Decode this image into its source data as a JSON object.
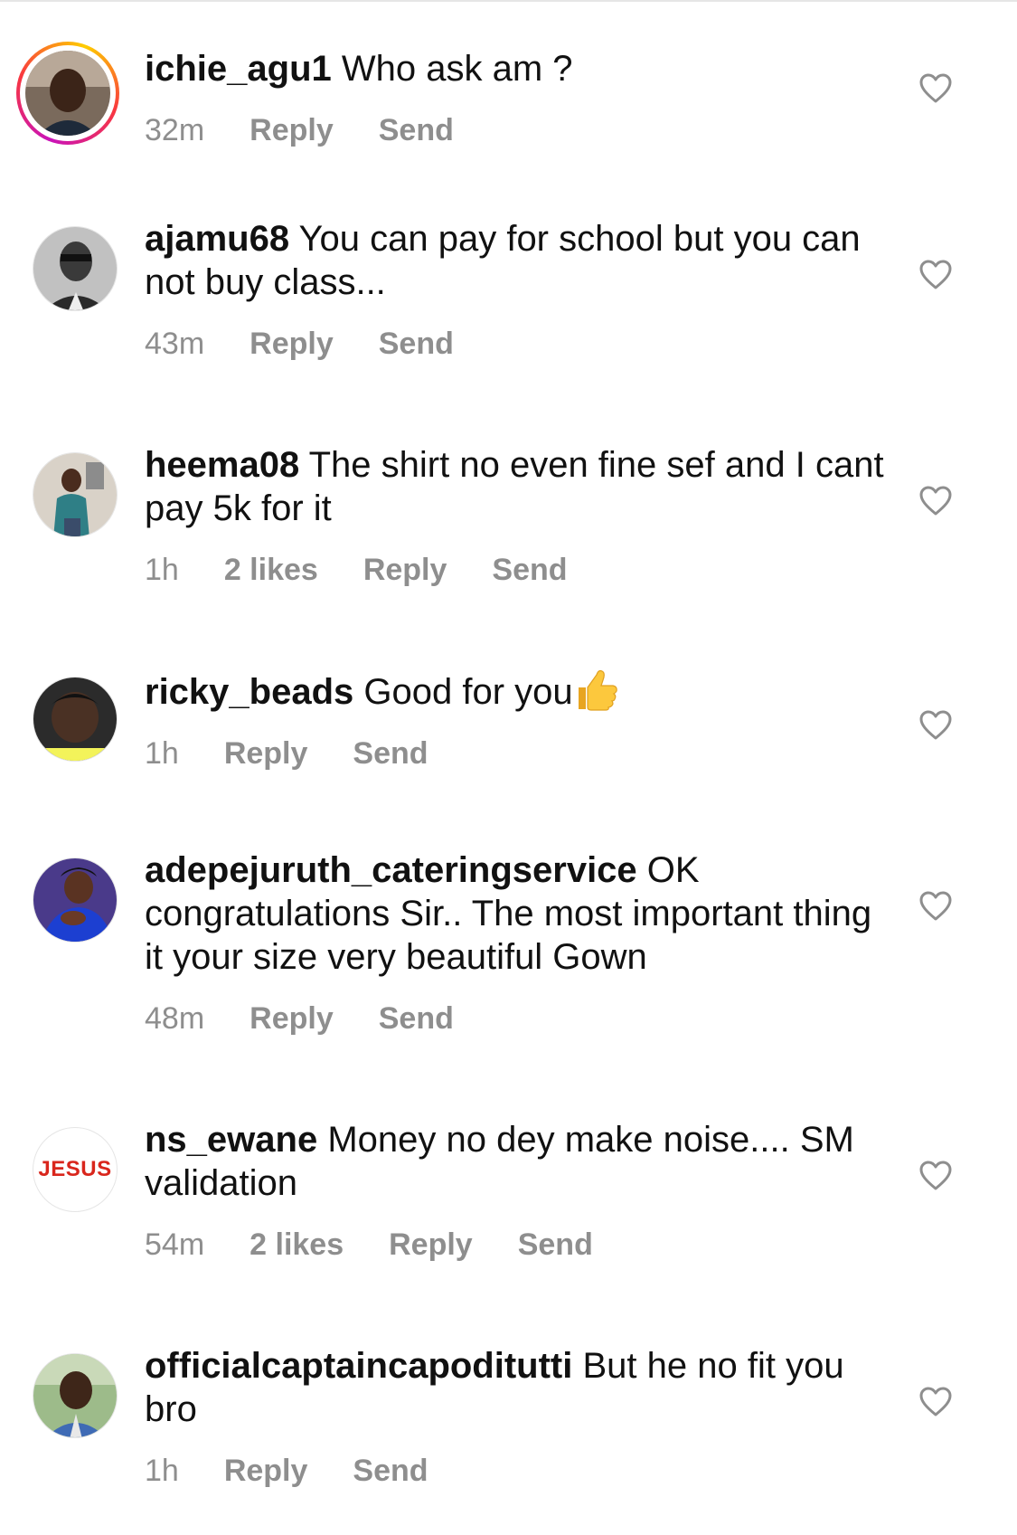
{
  "comments": [
    {
      "username": "ichie_agu1",
      "text": "Who ask am ?",
      "time": "32m",
      "likes": "",
      "reply_label": "Reply",
      "send_label": "Send",
      "avatar_icon": "user-photo-avatar",
      "has_story_ring": true
    },
    {
      "username": "ajamu68",
      "text": "You can pay for school but you can not buy class...",
      "time": "43m",
      "likes": "",
      "reply_label": "Reply",
      "send_label": "Send",
      "avatar_icon": "user-photo-avatar"
    },
    {
      "username": "heema08",
      "text": "The shirt no even fine sef and I cant pay  5k for it",
      "time": "1h",
      "likes": "2 likes",
      "reply_label": "Reply",
      "send_label": "Send",
      "avatar_icon": "user-photo-avatar"
    },
    {
      "username": "ricky_beads",
      "text": "Good for you",
      "emoji": "thumbs-up-emoji",
      "time": "1h",
      "likes": "",
      "reply_label": "Reply",
      "send_label": "Send",
      "avatar_icon": "user-photo-avatar"
    },
    {
      "username": "adepejuruth_cateringservice",
      "text": "OK congratulations Sir.. The most important thing it your size very beautiful Gown",
      "time": "48m",
      "likes": "",
      "reply_label": "Reply",
      "send_label": "Send",
      "avatar_icon": "user-photo-avatar"
    },
    {
      "username": "ns_ewane",
      "text": "Money no dey make noise.... SM validation",
      "time": "54m",
      "likes": "2 likes",
      "reply_label": "Reply",
      "send_label": "Send",
      "avatar_icon": "jesus-text-avatar",
      "avatar_text": "JESUS"
    },
    {
      "username": "officialcaptaincapoditutti",
      "text": "But he no fit you bro",
      "time": "1h",
      "likes": "",
      "reply_label": "Reply",
      "send_label": "Send",
      "avatar_icon": "user-photo-avatar"
    }
  ],
  "colors": {
    "text": "#111111",
    "meta": "#8e8e8e",
    "jesus_red": "#d9261c",
    "story_ring": [
      "#c913b9",
      "#f9373f",
      "#fecd00"
    ]
  },
  "icons": {
    "like": "heart-outline-icon"
  }
}
